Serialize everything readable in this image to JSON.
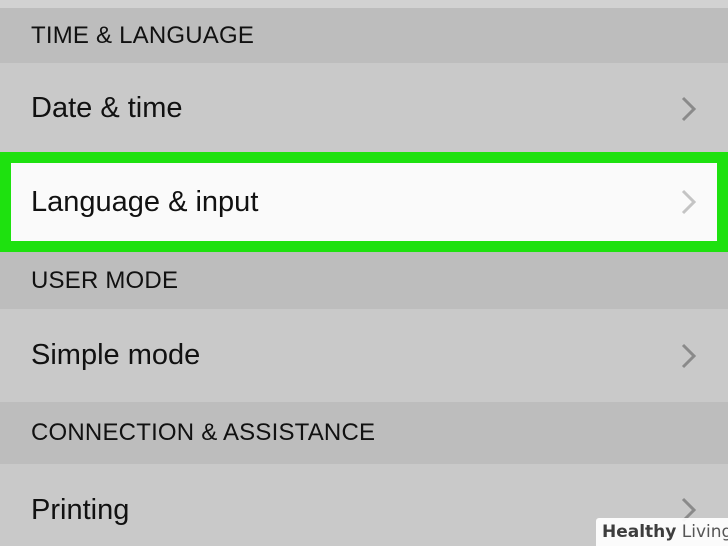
{
  "sections": [
    {
      "header": "TIME & LANGUAGE",
      "items": [
        {
          "label": "Date & time"
        },
        {
          "label": "Language & input"
        }
      ]
    },
    {
      "header": "USER MODE",
      "items": [
        {
          "label": "Simple mode"
        }
      ]
    },
    {
      "header": "CONNECTION & ASSISTANCE",
      "items": [
        {
          "label": "Printing"
        }
      ]
    }
  ],
  "highlight_color": "#1ee10f",
  "icons": {
    "chevron": "chevron-right-icon",
    "watermark_logo": "healthy-living-plus-icon"
  },
  "watermark": {
    "part1": "Healthy",
    "part2": " Living"
  }
}
